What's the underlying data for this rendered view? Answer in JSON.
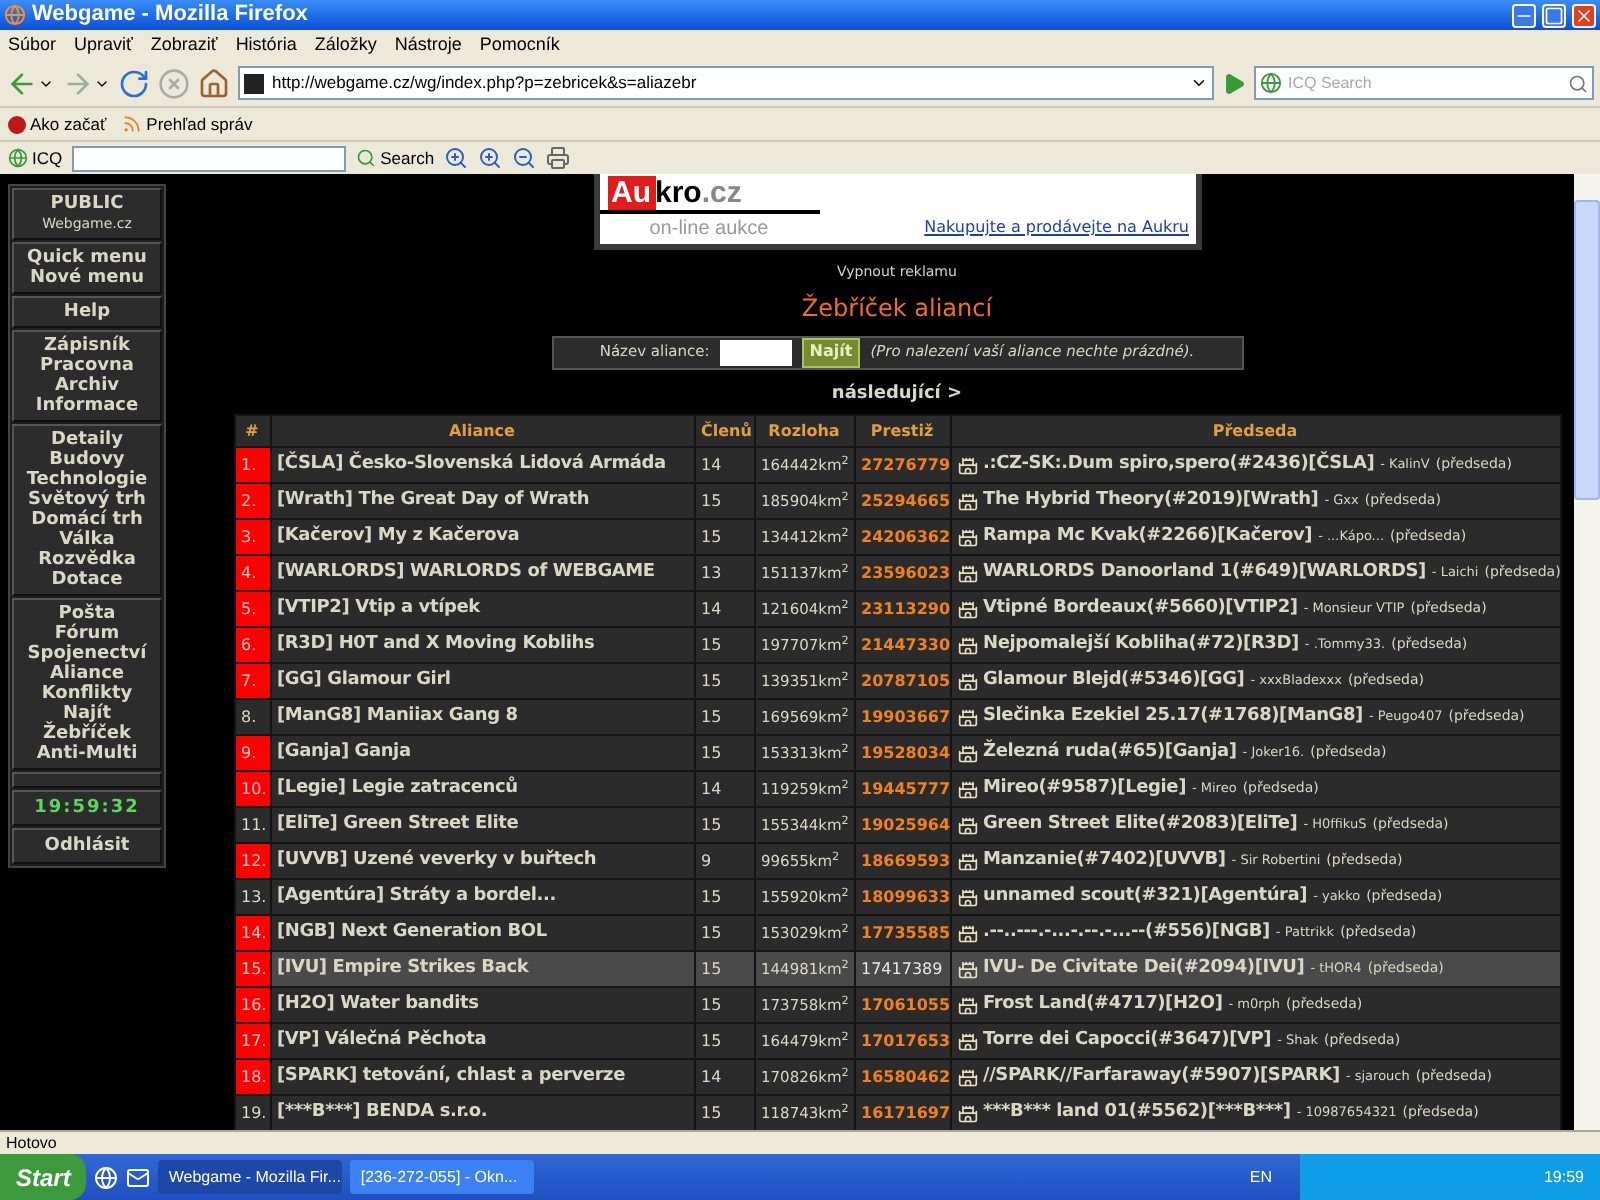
{
  "window": {
    "title": "Webgame - Mozilla Firefox"
  },
  "menu": [
    "Súbor",
    "Upraviť",
    "Zobraziť",
    "História",
    "Záložky",
    "Nástroje",
    "Pomocník"
  ],
  "address": {
    "url": "http://webgame.cz/wg/index.php?p=zebricek&s=aliazebr"
  },
  "search": {
    "placeholder": "ICQ Search"
  },
  "bookmarks": [
    "Ako začať",
    "Prehľad správ"
  ],
  "icq_toolbar": {
    "label": "ICQ",
    "search_button": "Search"
  },
  "sidebar": {
    "title": "PUBLIC",
    "subtitle": "Webgame.cz",
    "groups": [
      [
        "Quick menu",
        "Nové menu"
      ],
      [
        "Help"
      ],
      [
        "Zápisník",
        "Pracovna",
        "Archiv",
        "Informace"
      ],
      [
        "Detaily",
        "Budovy",
        "Technologie",
        "Světový trh",
        "Domácí trh",
        "Válka",
        "Rozvědka",
        "Dotace"
      ],
      [
        "Pošta",
        "Fórum",
        "Spojenectví",
        "Aliance",
        "Konflikty",
        "Najít",
        "Žebříček",
        "Anti-Multi"
      ]
    ],
    "clock": "19:59:32",
    "logout": "Odhlásit"
  },
  "ad": {
    "logo": [
      "Au",
      "kro",
      ".cz"
    ],
    "tagline": "on-line aukce",
    "link": "Nakupujte a prodávejte na Aukru"
  },
  "ad_toggle": "Vypnout reklamu",
  "heading": "Žebříček aliancí",
  "search_form": {
    "label": "Název aliance:",
    "button": "Najít",
    "hint": "(Pro nalezení vaší aliance nechte prázdné)."
  },
  "pager": "následující >",
  "table": {
    "columns": [
      "#",
      "Aliance",
      "Členů",
      "Rozloha",
      "Prestiž",
      "Předseda"
    ],
    "rows": [
      {
        "rank": "1.",
        "name": "[ČSLA] Česko-Slovenská Lidová Armáda",
        "members": "14",
        "area": "164442km$^{2}$",
        "prestige": "27276779",
        "marked": true,
        "selected": false,
        "city": ".:CZ-SK:.Dum spiro,spero(#2436)[ČSLA]",
        "player": "- KalinV",
        "role": "(předseda)"
      },
      {
        "rank": "2.",
        "name": "[Wrath] The Great Day of Wrath",
        "members": "15",
        "area": "185904km$^{2}$",
        "prestige": "25294665",
        "marked": true,
        "selected": false,
        "city": "The Hybrid Theory(#2019)[Wrath]",
        "player": "- Gxx",
        "role": "(předseda)"
      },
      {
        "rank": "3.",
        "name": "[Kačerov] My z Kačerova",
        "members": "15",
        "area": "134412km$^{2}$",
        "prestige": "24206362",
        "marked": true,
        "selected": false,
        "city": "Rampa Mc Kvak(#2266)[Kačerov]",
        "player": "- ...Kápo...",
        "role": "(předseda)"
      },
      {
        "rank": "4.",
        "name": "[WARLORDS] WARLORDS of WEBGAME",
        "members": "13",
        "area": "151137km$^{2}$",
        "prestige": "23596023",
        "marked": true,
        "selected": false,
        "city": "WARLORDS Danoorland 1(#649)[WARLORDS]",
        "player": "- Laichi",
        "role": "(předseda)"
      },
      {
        "rank": "5.",
        "name": "[VTIP2] Vtip a vtípek",
        "members": "14",
        "area": "121604km$^{2}$",
        "prestige": "23113290",
        "marked": true,
        "selected": false,
        "city": "Vtipné Bordeaux(#5660)[VTIP2]",
        "player": "- Monsieur VTIP",
        "role": "(předseda)"
      },
      {
        "rank": "6.",
        "name": "[R3D] H0T and X Moving Koblihs",
        "members": "15",
        "area": "197707km$^{2}$",
        "prestige": "21447330",
        "marked": true,
        "selected": false,
        "city": "Nejpomalejší Kobliha(#72)[R3D]",
        "player": "- .Tommy33.",
        "role": "(předseda)"
      },
      {
        "rank": "7.",
        "name": "[GG] Glamour Girl",
        "members": "15",
        "area": "139351km$^{2}$",
        "prestige": "20787105",
        "marked": true,
        "selected": false,
        "city": "Glamour Blejd(#5346)[GG]",
        "player": "- xxxBladexxx",
        "role": "(předseda)"
      },
      {
        "rank": "8.",
        "name": "[ManG8] Maniiax Gang 8",
        "members": "15",
        "area": "169569km$^{2}$",
        "prestige": "19903667",
        "marked": false,
        "selected": false,
        "city": "Slečinka Ezekiel 25.17(#1768)[ManG8]",
        "player": "- Peugo407",
        "role": "(předseda)"
      },
      {
        "rank": "9.",
        "name": "[Ganja] Ganja",
        "members": "15",
        "area": "153313km$^{2}$",
        "prestige": "19528034",
        "marked": true,
        "selected": false,
        "city": "Železná ruda(#65)[Ganja]",
        "player": "- Joker16.",
        "role": "(předseda)"
      },
      {
        "rank": "10.",
        "name": "[Legie] Legie zatracenců",
        "members": "14",
        "area": "119259km$^{2}$",
        "prestige": "19445777",
        "marked": true,
        "selected": false,
        "city": "Mireo(#9587)[Legie]",
        "player": "- Mireo",
        "role": "(předseda)"
      },
      {
        "rank": "11.",
        "name": "[EliTe] Green Street Elite",
        "members": "15",
        "area": "155344km$^{2}$",
        "prestige": "19025964",
        "marked": false,
        "selected": false,
        "city": "Green Street Elite(#2083)[EliTe]",
        "player": "- H0ffikuS",
        "role": "(předseda)"
      },
      {
        "rank": "12.",
        "name": "[UVVB] Uzené veverky v buřtech",
        "members": "9",
        "area": "99655km$^{2}$",
        "prestige": "18669593",
        "marked": true,
        "selected": false,
        "city": "Manzanie(#7402)[UVVB]",
        "player": "- Sir Robertini",
        "role": "(předseda)"
      },
      {
        "rank": "13.",
        "name": "[Agentúra] Stráty a bordel...",
        "members": "15",
        "area": "155920km$^{2}$",
        "prestige": "18099633",
        "marked": false,
        "selected": false,
        "city": "unnamed scout(#321)[Agentúra]",
        "player": "- yakko",
        "role": "(předseda)"
      },
      {
        "rank": "14.",
        "name": "[NGB] Next Generation BOL",
        "members": "15",
        "area": "153029km$^{2}$",
        "prestige": "17735585",
        "marked": true,
        "selected": false,
        "city": ".--..---.-...-.--.-...--(#556)[NGB]",
        "player": "- Pattrikk",
        "role": "(předseda)"
      },
      {
        "rank": "15.",
        "name": "[IVU] Empire Strikes Back",
        "members": "15",
        "area": "144981km$^{2}$",
        "prestige": "17417389",
        "marked": true,
        "selected": true,
        "city": "IVU- De Civitate Dei(#2094)[IVU]",
        "player": "- tHOR4",
        "role": "(předseda)"
      },
      {
        "rank": "16.",
        "name": "[H2O] Water bandits",
        "members": "15",
        "area": "173758km$^{2}$",
        "prestige": "17061055",
        "marked": true,
        "selected": false,
        "city": "Frost Land(#4717)[H2O]",
        "player": "- m0rph",
        "role": "(předseda)"
      },
      {
        "rank": "17.",
        "name": "[VP] Válečná Pěchota",
        "members": "15",
        "area": "164479km$^{2}$",
        "prestige": "17017653",
        "marked": true,
        "selected": false,
        "city": "Torre dei Capocci(#3647)[VP]",
        "player": "- Shak",
        "role": "(předseda)"
      },
      {
        "rank": "18.",
        "name": "[SPARK] tetování, chlast a perverze",
        "members": "14",
        "area": "170826km$^{2}$",
        "prestige": "16580462",
        "marked": true,
        "selected": false,
        "city": "//SPARK//Farfaraway(#5907)[SPARK]",
        "player": "- sjarouch",
        "role": "(předseda)"
      },
      {
        "rank": "19.",
        "name": "[***B***] BENDA s.r.o.",
        "members": "15",
        "area": "118743km$^{2}$",
        "prestige": "16171697",
        "marked": false,
        "selected": false,
        "city": "***B*** land 01(#5562)[***B***]",
        "player": "- 10987654321",
        "role": "(předseda)"
      }
    ]
  },
  "status_bar": "Hotovo",
  "taskbar": {
    "start": "Start",
    "tasks": [
      {
        "label": "Webgame - Mozilla Fir...",
        "selected": true
      },
      {
        "label": "[236-272-055] - Okn...",
        "selected": false
      }
    ],
    "language": "EN",
    "time": "19:59"
  }
}
